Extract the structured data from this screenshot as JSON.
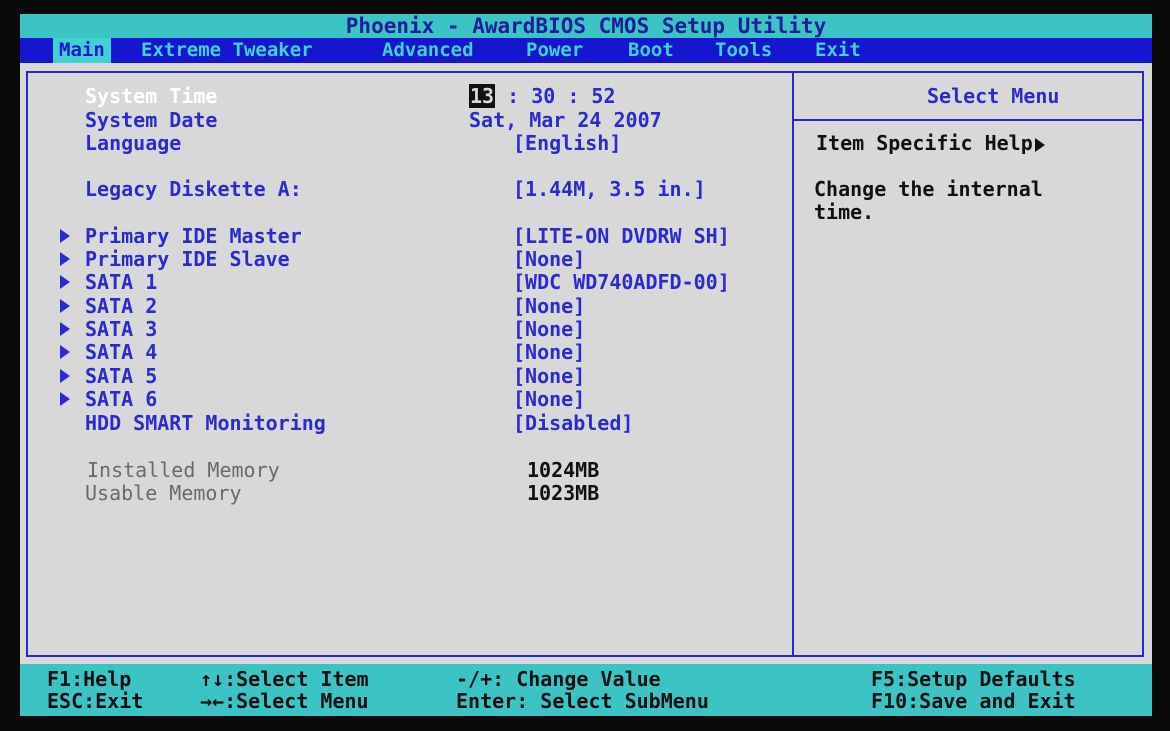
{
  "title": "Phoenix - AwardBIOS CMOS Setup Utility",
  "menu": [
    "Main",
    "Extreme Tweaker",
    "Advanced",
    "Power",
    "Boot",
    "Tools",
    "Exit"
  ],
  "main": {
    "system_time": {
      "label": "System Time",
      "hour": "13",
      "rest": " : 30 : 52"
    },
    "system_date": {
      "label": "System Date",
      "value": "Sat, Mar 24 2007"
    },
    "language": {
      "label": "Language",
      "value": "[English]"
    },
    "legacy_diskette": {
      "label": "Legacy Diskette A:",
      "value": "[1.44M, 3.5 in.]"
    },
    "submenus": [
      {
        "label": "Primary IDE Master",
        "value": "[LITE-ON DVDRW SH]"
      },
      {
        "label": "Primary IDE Slave",
        "value": "[None]"
      },
      {
        "label": "SATA 1",
        "value": "[WDC WD740ADFD-00]"
      },
      {
        "label": "SATA 2",
        "value": "[None]"
      },
      {
        "label": "SATA 3",
        "value": "[None]"
      },
      {
        "label": "SATA 4",
        "value": "[None]"
      },
      {
        "label": "SATA 5",
        "value": "[None]"
      },
      {
        "label": "SATA 6",
        "value": "[None]"
      }
    ],
    "hdd_smart": {
      "label": "HDD SMART Monitoring",
      "value": "[Disabled]"
    },
    "installed_memory": {
      "label": "Installed Memory",
      "value": "1024MB"
    },
    "usable_memory": {
      "label": "Usable Memory",
      "value": "1023MB"
    }
  },
  "help": {
    "header": "Select Menu",
    "title": "Item Specific Help",
    "line1": "Change the internal",
    "line2": "time."
  },
  "footer": {
    "f1": "F1:Help",
    "esc": "ESC:Exit",
    "select_item": "↑↓:Select Item",
    "select_menu": "→←:Select Menu",
    "change_value": "-/+: Change Value",
    "enter": "Enter: Select SubMenu",
    "f5": "F5:Setup Defaults",
    "f10": "F10:Save and Exit"
  },
  "colors": {
    "background": "#d9d8d9",
    "title_bar": "#3cc4c4",
    "menu_bar": "#1616d0",
    "text_blue": "#2a2ad0",
    "selected": "#ffffff"
  }
}
